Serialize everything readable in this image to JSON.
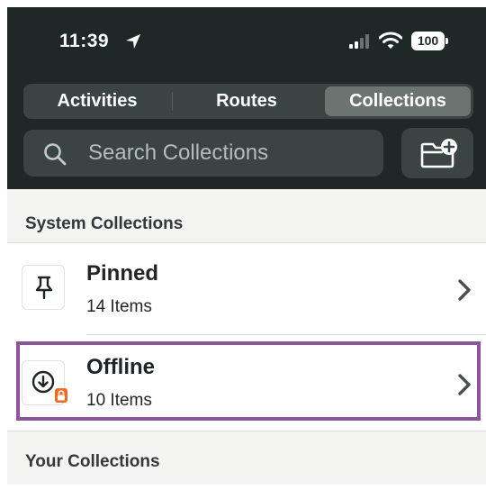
{
  "status_bar": {
    "time": "11:39",
    "battery": "100",
    "icons": [
      "location-arrow-icon",
      "cellular-signal-icon",
      "wifi-icon",
      "battery-icon"
    ]
  },
  "tabs": [
    {
      "label": "Activities",
      "selected": false
    },
    {
      "label": "Routes",
      "selected": false
    },
    {
      "label": "Collections",
      "selected": true
    }
  ],
  "search": {
    "placeholder": "Search Collections",
    "value": "",
    "icon": "search-icon"
  },
  "new_collection_icon": "new-folder-plus-icon",
  "sections": {
    "system": {
      "title": "System Collections",
      "items": [
        {
          "title": "Pinned",
          "count": "14 Items",
          "icon": "pin-icon"
        },
        {
          "title": "Offline",
          "count": "10 Items",
          "icon": "download-circle-icon",
          "badge_icon": "lock-icon"
        }
      ]
    },
    "yours": {
      "title": "Your Collections"
    }
  },
  "colors": {
    "header_background": "#1e2826",
    "segment_background": "#3a4442",
    "segment_selected": "#6c7472",
    "highlight_border": "#8a559b",
    "lock_badge": "#f26a21"
  }
}
